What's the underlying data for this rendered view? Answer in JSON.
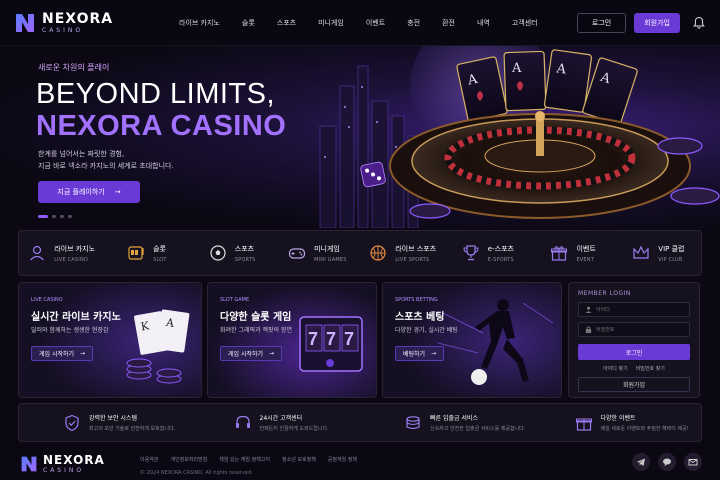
{
  "brand": {
    "name": "NEXORA",
    "sub": "CASINO"
  },
  "nav": [
    "라이브 카지노",
    "슬롯",
    "스포츠",
    "미니게임",
    "이벤트",
    "충전",
    "환전",
    "내역",
    "고객센터"
  ],
  "header": {
    "login": "로그인",
    "signup": "회원가입"
  },
  "hero": {
    "kicker": "새로운 차원의 플레이",
    "line1": "BEYOND LIMITS,",
    "line2": "NEXORA CASINO",
    "desc1": "한계를 넘어서는 짜릿한 경험,",
    "desc2": "지금 바로 넥소라 카지노의 세계로 초대합니다.",
    "cta": "지금 플레이하기",
    "slide_count": 4,
    "active_slide": 1
  },
  "categories": [
    {
      "label": "라이브 카지노",
      "sub": "LIVE CASINO",
      "icon": "dealer-icon"
    },
    {
      "label": "슬롯",
      "sub": "SLOT",
      "icon": "slot-machine-icon"
    },
    {
      "label": "스포츠",
      "sub": "SPORTS",
      "icon": "soccer-ball-icon"
    },
    {
      "label": "미니게임",
      "sub": "MINI GAMES",
      "icon": "gamepad-icon"
    },
    {
      "label": "라이브 스포츠",
      "sub": "LIVE SPORTS",
      "icon": "basketball-icon"
    },
    {
      "label": "e-스포츠",
      "sub": "E-SPORTS",
      "icon": "trophy-icon"
    },
    {
      "label": "이벤트",
      "sub": "EVENT",
      "icon": "gift-icon"
    },
    {
      "label": "VIP 클럽",
      "sub": "VIP CLUB",
      "icon": "crown-icon"
    }
  ],
  "cards": [
    {
      "tag": "LIVE CASINO",
      "title": "실시간 라이브 카지노",
      "desc": "딜러와 함께하는 생생한 현장감",
      "button": "게임 시작하기"
    },
    {
      "tag": "SLOT GAME",
      "title": "다양한 슬롯 게임",
      "desc": "화려한 그래픽과 잭팟의 향연",
      "button": "게임 시작하기"
    },
    {
      "tag": "SPORTS BETTING",
      "title": "스포츠 베팅",
      "desc": "다양한 경기, 실시간 베팅",
      "button": "베팅하기"
    }
  ],
  "login_panel": {
    "title": "MEMBER LOGIN",
    "id_placeholder": "아이디",
    "pw_placeholder": "비밀번호",
    "login": "로그인",
    "find_id": "아이디 찾기",
    "find_pw": "비밀번호 찾기",
    "register": "회원가입"
  },
  "features": [
    {
      "title": "강력한 보안 시스템",
      "desc": "최고의 보안 기술로 안전하게 보호합니다.",
      "icon": "shield-check-icon"
    },
    {
      "title": "24시간 고객센터",
      "desc": "언제든지 친절하게 도와드립니다.",
      "icon": "headset-icon"
    },
    {
      "title": "빠른 입출금 서비스",
      "desc": "신속하고 안전한 입출금 서비스를 제공합니다.",
      "icon": "coins-icon"
    },
    {
      "title": "다양한 이벤트",
      "desc": "매일 새로운 이벤트와 푸짐한 혜택이 제공!",
      "icon": "gift-icon"
    }
  ],
  "footer": {
    "links": [
      "이용약관",
      "개인정보처리방침",
      "책임 있는 게임 정책고지",
      "청소년 보호정책",
      "공정게임 정책"
    ],
    "copyright": "© 2024 NEXORA CASINO. All rights reserved.",
    "social": [
      "telegram-icon",
      "chat-icon",
      "mail-icon"
    ]
  },
  "colors": {
    "accent": "#6a3ad6",
    "accent_light": "#a272ff",
    "bg": "#0b0813",
    "panel": "#15111e"
  }
}
